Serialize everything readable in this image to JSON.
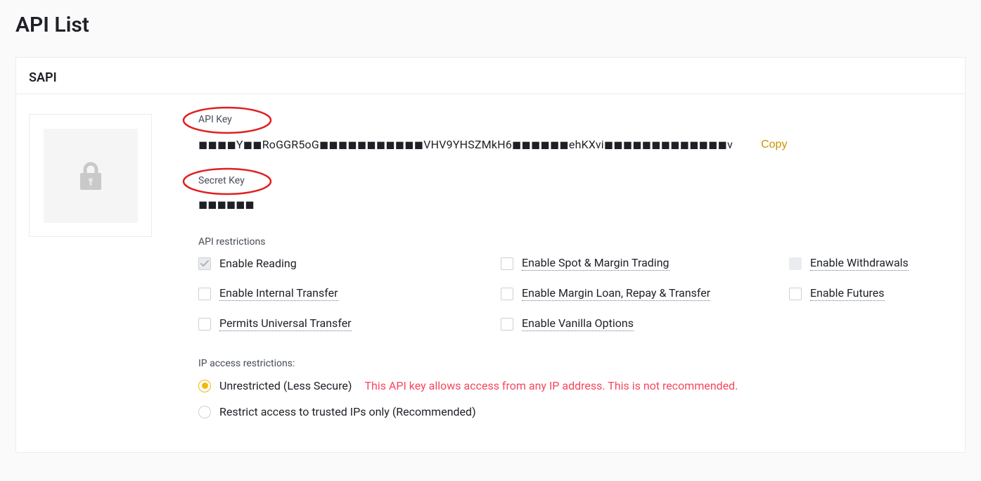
{
  "page_title": "API List",
  "api_name": "SAPI",
  "labels": {
    "api_key": "API Key",
    "secret_key": "Secret Key",
    "api_restrictions": "API restrictions",
    "ip_restrictions": "IP access restrictions:"
  },
  "api_key_value": "◼◼◼◼Y◼◼RoGGR5oG◼◼◼◼◼◼◼◼◼◼◼VHV9YHSZMkH6◼◼◼◼◼◼ehKXvi◼◼◼◼◼◼◼◼◼◼◼◼◼v",
  "secret_key_value": "◼◼◼◼◼◼",
  "copy_label": "Copy",
  "restrictions": [
    {
      "label": "Enable Reading",
      "underline": false
    },
    {
      "label": "Enable Spot & Margin Trading",
      "underline": true
    },
    {
      "label": "Enable Withdrawals",
      "underline": true
    },
    {
      "label": "Enable Internal Transfer",
      "underline": true
    },
    {
      "label": "Enable Margin Loan, Repay & Transfer",
      "underline": true
    },
    {
      "label": "Enable Futures",
      "underline": true
    },
    {
      "label": "Permits Universal Transfer",
      "underline": true
    },
    {
      "label": "Enable Vanilla Options",
      "underline": true
    }
  ],
  "ip_options": {
    "unrestricted_label": "Unrestricted (Less Secure)",
    "unrestricted_warning": "This API key allows access from any IP address. This is not recommended.",
    "restricted_label": "Restrict access to trusted IPs only (Recommended)"
  }
}
